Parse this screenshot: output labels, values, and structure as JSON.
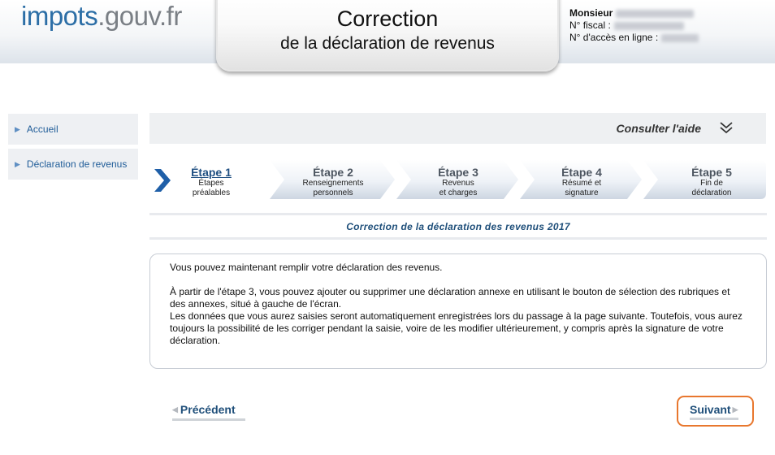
{
  "header": {
    "logo_part1": "impots",
    "logo_part2": ".gouv.fr",
    "title_line1": "Correction",
    "title_line2": "de la déclaration de revenus",
    "user": {
      "civility": "Monsieur",
      "fiscal_label": "N° fiscal :",
      "access_label": "N° d'accès en ligne :"
    }
  },
  "sidebar": {
    "items": [
      {
        "label": "Accueil",
        "icon": "triangle-right-icon"
      },
      {
        "label": "Déclaration de revenus",
        "icon": "triangle-right-icon"
      }
    ]
  },
  "help": {
    "label": "Consulter l'aide",
    "icon": "double-chevron-down-icon"
  },
  "steps": [
    {
      "title": "Étape 1",
      "sub1": "Étapes",
      "sub2": "préalables",
      "active": true
    },
    {
      "title": "Étape 2",
      "sub1": "Renseignements",
      "sub2": "personnels",
      "active": false
    },
    {
      "title": "Étape 3",
      "sub1": "Revenus",
      "sub2": "et charges",
      "active": false
    },
    {
      "title": "Étape 4",
      "sub1": "Résumé et",
      "sub2": "signature",
      "active": false
    },
    {
      "title": "Étape 5",
      "sub1": "Fin de",
      "sub2": "déclaration",
      "active": false
    }
  ],
  "section_title": "Correction de la déclaration des revenus 2017",
  "content": {
    "p1": "Vous pouvez maintenant remplir votre déclaration des revenus.",
    "p2": "À partir de l'étape 3, vous pouvez ajouter ou supprimer une déclaration annexe en utilisant le bouton de sélection des rubriques et des annexes, situé à gauche de l'écran.",
    "p3": "Les données que vous aurez saisies seront automatiquement enregistrées lors du passage à la page suivante. Toutefois, vous aurez toujours la possibilité de les corriger pendant la saisie, voire de les modifier ultérieurement, y compris après la signature de votre déclaration."
  },
  "nav": {
    "prev_label": "Précédent",
    "next_label": "Suivant"
  },
  "colors": {
    "link_blue": "#1f4f7a",
    "accent_orange": "#e8772e",
    "active_chevron": "#1f5fa8"
  }
}
